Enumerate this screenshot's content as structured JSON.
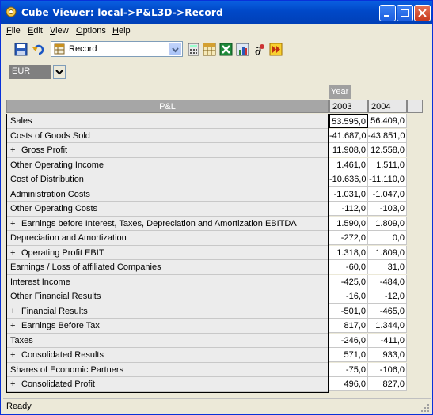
{
  "window": {
    "title": "Cube Viewer:  local->P&L3D->Record"
  },
  "menu": [
    {
      "label": "File",
      "key": "F",
      "rest": "ile"
    },
    {
      "label": "Edit",
      "key": "E",
      "rest": "dit"
    },
    {
      "label": "View",
      "key": "V",
      "rest": "iew"
    },
    {
      "label": "Options",
      "key": "O",
      "rest": "ptions"
    },
    {
      "label": "Help",
      "key": "H",
      "rest": "elp"
    }
  ],
  "toolbar": {
    "view_name": "Record"
  },
  "currency": {
    "selected": "EUR"
  },
  "grid": {
    "column_dimension": "Year",
    "row_dimension": "P&L",
    "years": [
      "2003",
      "2004"
    ],
    "rows": [
      {
        "label": "Sales",
        "expand": "",
        "v2003": "53.595,0",
        "v2004": "56.409,0"
      },
      {
        "label": "Costs of Goods Sold",
        "expand": "",
        "v2003": "-41.687,0",
        "v2004": "-43.851,0"
      },
      {
        "label": "Gross Profit",
        "expand": "+",
        "v2003": "11.908,0",
        "v2004": "12.558,0"
      },
      {
        "label": "Other Operating Income",
        "expand": "",
        "v2003": "1.461,0",
        "v2004": "1.511,0"
      },
      {
        "label": "Cost of Distribution",
        "expand": "",
        "v2003": "-10.636,0",
        "v2004": "-11.110,0"
      },
      {
        "label": "Administration Costs",
        "expand": "",
        "v2003": "-1.031,0",
        "v2004": "-1.047,0"
      },
      {
        "label": "Other Operating Costs",
        "expand": "",
        "v2003": "-112,0",
        "v2004": "-103,0"
      },
      {
        "label": "Earnings before Interest, Taxes, Depreciation and Amortization EBITDA",
        "expand": "+",
        "v2003": "1.590,0",
        "v2004": "1.809,0"
      },
      {
        "label": "Depreciation and Amortization",
        "expand": "",
        "v2003": "-272,0",
        "v2004": "0,0"
      },
      {
        "label": "Operating Profit EBIT",
        "expand": "+",
        "v2003": "1.318,0",
        "v2004": "1.809,0"
      },
      {
        "label": "Earnings / Loss of affiliated Companies",
        "expand": "",
        "v2003": "-60,0",
        "v2004": "31,0"
      },
      {
        "label": "Interest Income",
        "expand": "",
        "v2003": "-425,0",
        "v2004": "-484,0"
      },
      {
        "label": "Other Financial Results",
        "expand": "",
        "v2003": "-16,0",
        "v2004": "-12,0"
      },
      {
        "label": "Financial Results",
        "expand": "+",
        "v2003": "-501,0",
        "v2004": "-465,0"
      },
      {
        "label": "Earnings Before Tax",
        "expand": "+",
        "v2003": "817,0",
        "v2004": "1.344,0"
      },
      {
        "label": "Taxes",
        "expand": "",
        "v2003": "-246,0",
        "v2004": "-411,0"
      },
      {
        "label": "Consolidated Results",
        "expand": "+",
        "v2003": "571,0",
        "v2004": "933,0"
      },
      {
        "label": "Shares of Economic Partners",
        "expand": "",
        "v2003": "-75,0",
        "v2004": "-106,0"
      },
      {
        "label": "Consolidated Profit",
        "expand": "+",
        "v2003": "496,0",
        "v2004": "827,0"
      }
    ]
  },
  "status": {
    "text": "Ready"
  },
  "icons": {
    "app": "cube-viewer-app-icon",
    "toolbar": [
      "save-icon",
      "undo-icon",
      "view-icon",
      "calculator-icon",
      "table-icon",
      "excel-export-icon",
      "chart-icon",
      "formula-icon",
      "forward-icon"
    ]
  }
}
